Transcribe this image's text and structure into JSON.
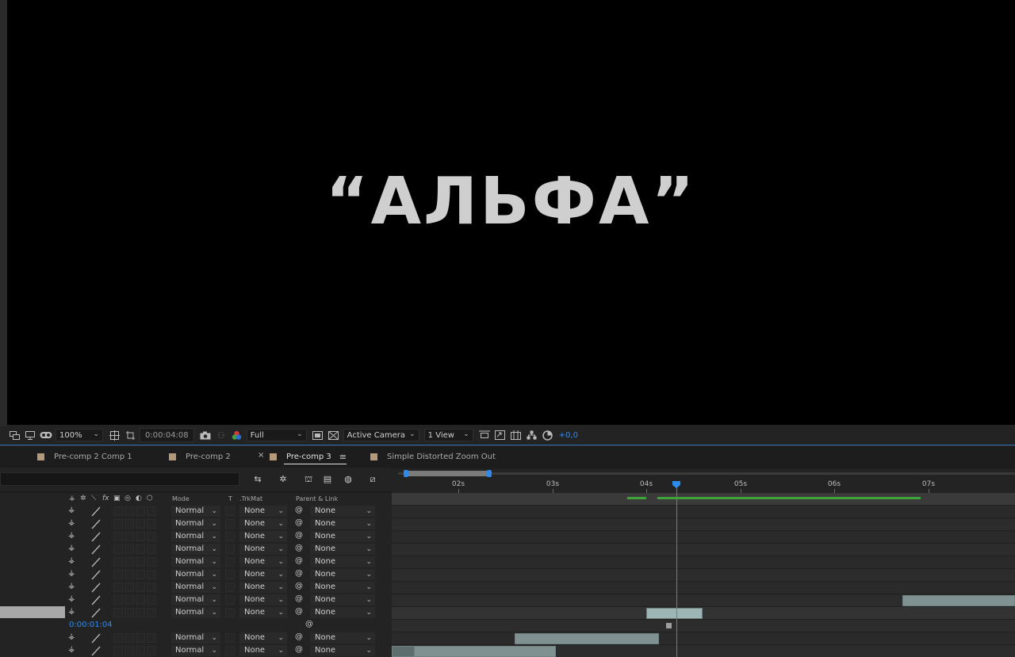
{
  "viewer": {
    "comp_text": "“АЛЬФА”"
  },
  "viewer_bar": {
    "zoom": "100%",
    "timecode": "0:00:04:08",
    "resolution": "Full",
    "camera": "Active Camera",
    "views": "1 View",
    "exposure": "+0,0"
  },
  "tabs": [
    {
      "label": "Pre-comp 2 Comp 1"
    },
    {
      "label": "Pre-comp 2"
    },
    {
      "label": "Pre-comp 3"
    },
    {
      "label": "Simple Distorted Zoom Out"
    }
  ],
  "columns": {
    "mode": "Mode",
    "t": "T",
    "trkmat": ".TrkMat",
    "parent": "Parent & Link"
  },
  "layers": [
    {
      "mode": "Normal",
      "trkmat": "None",
      "parent": "None"
    },
    {
      "mode": "Normal",
      "trkmat": "None",
      "parent": "None"
    },
    {
      "mode": "Normal",
      "trkmat": "None",
      "parent": "None"
    },
    {
      "mode": "Normal",
      "trkmat": "None",
      "parent": "None"
    },
    {
      "mode": "Normal",
      "trkmat": "None",
      "parent": "None"
    },
    {
      "mode": "Normal",
      "trkmat": "None",
      "parent": "None"
    },
    {
      "mode": "Normal",
      "trkmat": "None",
      "parent": "None"
    },
    {
      "mode": "Normal",
      "trkmat": "None",
      "parent": "None"
    },
    {
      "mode": "Normal",
      "trkmat": "None",
      "parent": "None"
    },
    {
      "mode": "Normal",
      "trkmat": "None",
      "parent": "None"
    },
    {
      "mode": "Normal",
      "trkmat": "None",
      "parent": "None"
    }
  ],
  "time_remap_value": "0:00:01:04",
  "ruler": [
    "02s",
    "03s",
    "04s",
    "05s",
    "06s",
    "07s"
  ],
  "colors": {
    "accent": "#2d8ceb",
    "work_area": "#3fa33a",
    "label_tan": "#b29a7a",
    "clip": "#7f9291"
  }
}
